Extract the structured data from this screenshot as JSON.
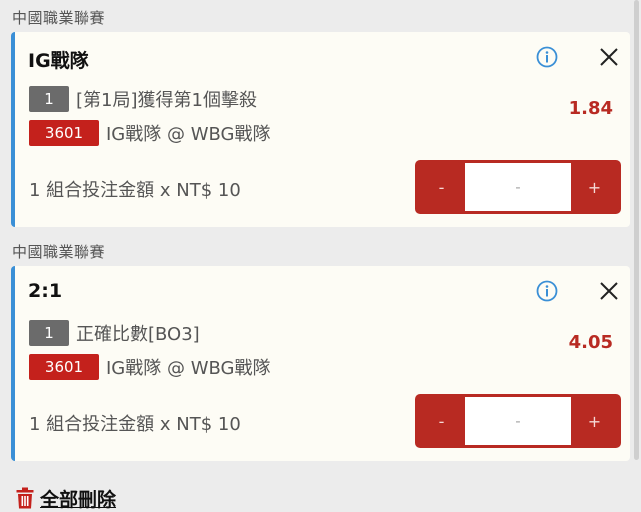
{
  "bets": [
    {
      "league": "中國職業聯賽",
      "title": "IG戰隊",
      "count": "1",
      "market": "[第1局]獲得第1個擊殺",
      "event_id": "3601",
      "match": "IG戰隊 @ WBG戰隊",
      "odds": "1.84",
      "stake_text": "1 組合投注金額 x NT$ 10",
      "minus": "-",
      "value": "-",
      "plus": "+"
    },
    {
      "league": "中國職業聯賽",
      "title": "2:1",
      "count": "1",
      "market": "正確比數[BO3]",
      "event_id": "3601",
      "match": "IG戰隊 @ WBG戰隊",
      "odds": "4.05",
      "stake_text": "1 組合投注金額 x NT$ 10",
      "minus": "-",
      "value": "-",
      "plus": "+"
    }
  ],
  "delete_all_label": "全部刪除",
  "colors": {
    "accent_red": "#b82a22",
    "badge_red": "#c4211c",
    "card_border": "#3a8fd6",
    "card_bg": "#fdfcf5",
    "page_bg": "#ececec"
  },
  "icons": [
    "info-icon",
    "close-icon",
    "trash-icon"
  ]
}
